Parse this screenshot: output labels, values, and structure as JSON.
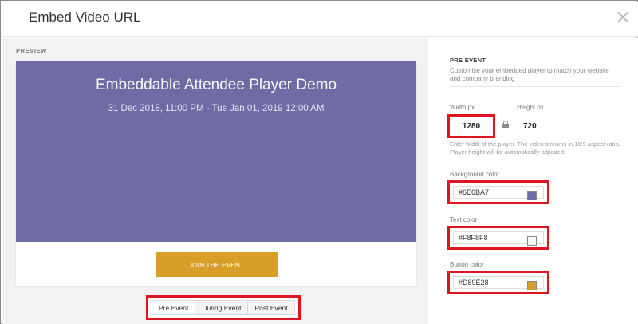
{
  "dialog": {
    "title": "Embed Video URL"
  },
  "preview": {
    "label": "PREVIEW",
    "event_title": "Embeddable Attendee Player Demo",
    "event_date": "31 Dec 2018, 11:00 PM - Tue Jan 01, 2019 12:00 AM",
    "join_label": "JOIN THE EVENT",
    "tabs": [
      "Pre Event",
      "During Event",
      "Post Event"
    ],
    "active_tab": "Pre Event"
  },
  "settings": {
    "section_title": "PRE EVENT",
    "section_desc": "Customise your embedded player to match your website and company branding",
    "width_label": "Width px",
    "width_value": "1280",
    "height_label": "Height px",
    "height_value": "720",
    "hint": "Enter width of the player. The video streams in 16:9 aspect ratio. Player height will be automatically adjusted.",
    "background_color_label": "Background color",
    "background_color_value": "#6E6BA7",
    "text_color_label": "Text color",
    "text_color_value": "#F8F8F8",
    "button_color_label": "Button color",
    "button_color_value": "#D89E28"
  },
  "colors": {
    "player_background": "#6E6BA7",
    "player_text": "#F8F8F8",
    "player_button": "#D89E28",
    "highlight": "#E0141E"
  }
}
